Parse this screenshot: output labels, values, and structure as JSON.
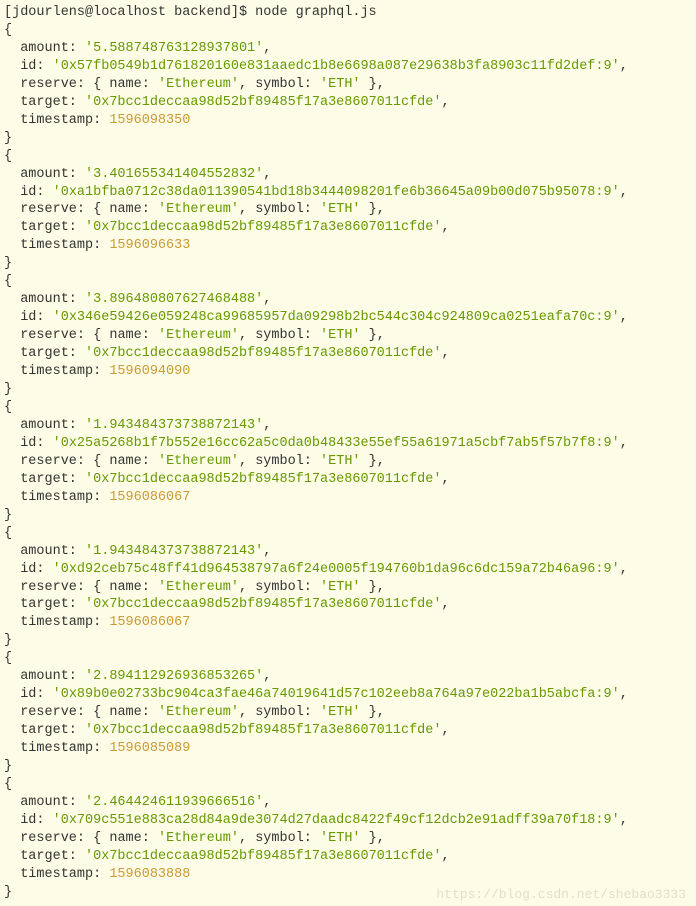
{
  "prompt": "[jdourlens@localhost backend]$ node graphql.js",
  "watermark": "https://blog.csdn.net/shebao3333",
  "entries": [
    {
      "amount": "'5.588748763128937801'",
      "id": "'0x57fb0549b1d761820160e831aaedc1b8e6698a087e29638b3fa8903c11fd2def:9'",
      "reserve_name": "'Ethereum'",
      "reserve_symbol": "'ETH'",
      "target": "'0x7bcc1deccaa98d52bf89485f17a3e8607011cfde'",
      "timestamp": "1596098350"
    },
    {
      "amount": "'3.401655341404552832'",
      "id": "'0xa1bfba0712c38da011390541bd18b3444098201fe6b36645a09b00d075b95078:9'",
      "reserve_name": "'Ethereum'",
      "reserve_symbol": "'ETH'",
      "target": "'0x7bcc1deccaa98d52bf89485f17a3e8607011cfde'",
      "timestamp": "1596096633"
    },
    {
      "amount": "'3.896480807627468488'",
      "id": "'0x346e59426e059248ca99685957da09298b2bc544c304c924809ca0251eafa70c:9'",
      "reserve_name": "'Ethereum'",
      "reserve_symbol": "'ETH'",
      "target": "'0x7bcc1deccaa98d52bf89485f17a3e8607011cfde'",
      "timestamp": "1596094090"
    },
    {
      "amount": "'1.943484373738872143'",
      "id": "'0x25a5268b1f7b552e16cc62a5c0da0b48433e55ef55a61971a5cbf7ab5f57b7f8:9'",
      "reserve_name": "'Ethereum'",
      "reserve_symbol": "'ETH'",
      "target": "'0x7bcc1deccaa98d52bf89485f17a3e8607011cfde'",
      "timestamp": "1596086067"
    },
    {
      "amount": "'1.943484373738872143'",
      "id": "'0xd92ceb75c48ff41d964538797a6f24e0005f194760b1da96c6dc159a72b46a96:9'",
      "reserve_name": "'Ethereum'",
      "reserve_symbol": "'ETH'",
      "target": "'0x7bcc1deccaa98d52bf89485f17a3e8607011cfde'",
      "timestamp": "1596086067"
    },
    {
      "amount": "'2.894112926936853265'",
      "id": "'0x89b0e02733bc904ca3fae46a74019641d57c102eeb8a764a97e022ba1b5abcfa:9'",
      "reserve_name": "'Ethereum'",
      "reserve_symbol": "'ETH'",
      "target": "'0x7bcc1deccaa98d52bf89485f17a3e8607011cfde'",
      "timestamp": "1596085089"
    },
    {
      "amount": "'2.464424611939666516'",
      "id": "'0x709c551e883ca28d84a9de3074d27daadc8422f49cf12dcb2e91adff39a70f18:9'",
      "reserve_name": "'Ethereum'",
      "reserve_symbol": "'ETH'",
      "target": "'0x7bcc1deccaa98d52bf89485f17a3e8607011cfde'",
      "timestamp": "1596083888"
    }
  ]
}
